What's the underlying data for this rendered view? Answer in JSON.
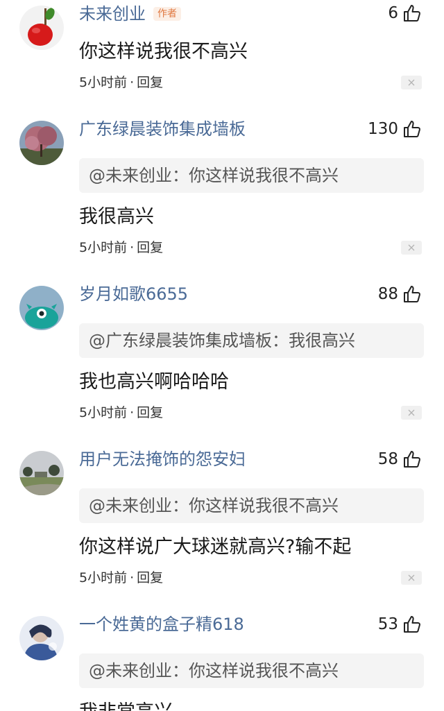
{
  "comments": [
    {
      "username": "未来创业",
      "author_tag": "作者",
      "likes": "6",
      "quote": "",
      "text": "你这样说我很不高兴",
      "time": "5小时前",
      "dot": "·",
      "reply": "回复",
      "avatar": "apple-avatar"
    },
    {
      "username": "广东绿晨装饰集成墙板",
      "likes": "130",
      "quote": "@未来创业：你这样说我很不高兴",
      "text": "我很高兴",
      "time": "5小时前",
      "dot": "·",
      "reply": "回复",
      "avatar": "tree-avatar"
    },
    {
      "username": "岁月如歌6655",
      "likes": "88",
      "quote": "@广东绿晨装饰集成墙板：我很高兴",
      "text": "我也高兴啊哈哈哈",
      "time": "5小时前",
      "dot": "·",
      "reply": "回复",
      "avatar": "teal-monster-avatar"
    },
    {
      "username": "用户无法掩饰的怨安妇",
      "likes": "58",
      "quote": "@未来创业：你这样说我很不高兴",
      "text": "你这样说广大球迷就高兴?输不起",
      "time": "5小时前",
      "dot": "·",
      "reply": "回复",
      "avatar": "park-avatar"
    },
    {
      "username": "一个姓黄的盒子精618",
      "likes": "53",
      "quote": "@未来创业：你这样说我很不高兴",
      "text": "我非常高兴",
      "avatar": "portrait-avatar"
    }
  ],
  "colors": {
    "username": "#4a6a96",
    "author_tag_bg": "#fcefe6",
    "author_tag_text": "#e07840",
    "quote_bg": "#f4f4f4"
  },
  "icons": {
    "like": "thumbs-up-icon",
    "dismiss": "close-icon"
  }
}
